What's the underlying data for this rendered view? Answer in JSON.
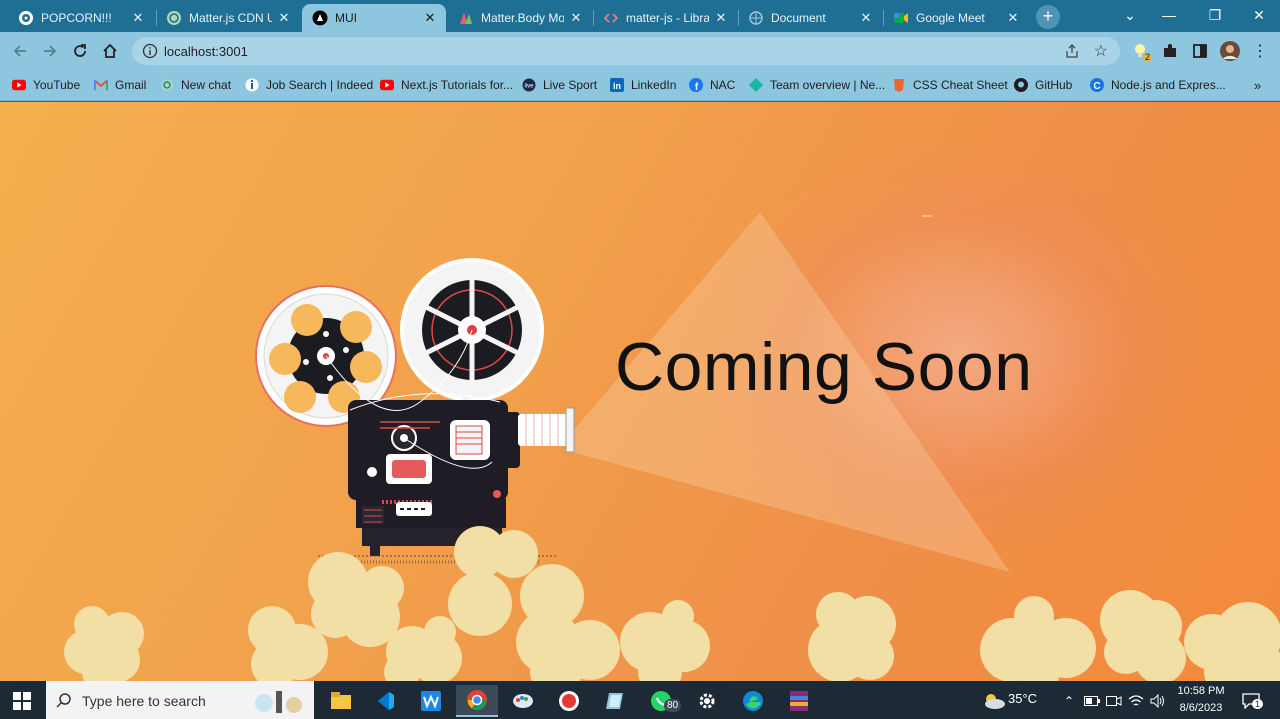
{
  "tabs": [
    {
      "title": "POPCORN!!!",
      "icon": "popcorn-logo-icon",
      "active": false
    },
    {
      "title": "Matter.js CDN Us",
      "icon": "chatgpt-icon",
      "active": false
    },
    {
      "title": "MUI",
      "icon": "nextjs-icon",
      "active": true
    },
    {
      "title": "Matter.Body Mod",
      "icon": "matterjs-icon",
      "active": false
    },
    {
      "title": "matter-js - Librar",
      "icon": "code-icon",
      "active": false
    },
    {
      "title": "Document",
      "icon": "globe-icon",
      "active": false
    },
    {
      "title": "Google Meet",
      "icon": "google-meet-icon",
      "active": false
    }
  ],
  "address_bar": {
    "url": "localhost:3001"
  },
  "extensions": {
    "badge_count": "2"
  },
  "bookmarks": [
    {
      "label": "YouTube",
      "icon": "youtube-icon"
    },
    {
      "label": "Gmail",
      "icon": "gmail-icon"
    },
    {
      "label": "New chat",
      "icon": "chatgpt-icon"
    },
    {
      "label": "Job Search | Indeed",
      "icon": "indeed-icon"
    },
    {
      "label": "Next.js Tutorials for...",
      "icon": "youtube-icon"
    },
    {
      "label": "Live Sport",
      "icon": "livesport-icon"
    },
    {
      "label": "LinkedIn",
      "icon": "linkedin-icon"
    },
    {
      "label": "NAC",
      "icon": "facebook-icon"
    },
    {
      "label": "Team overview | Ne...",
      "icon": "diamond-icon"
    },
    {
      "label": "CSS Cheat Sheet",
      "icon": "css-icon"
    },
    {
      "label": "GitHub",
      "icon": "github-icon"
    },
    {
      "label": "Node.js and Expres...",
      "icon": "c-icon"
    }
  ],
  "page": {
    "heading": "Coming Soon"
  },
  "taskbar": {
    "search_placeholder": "Type here to search",
    "whatsapp_badge": "80",
    "temperature": "35°C",
    "time": "10:58 PM",
    "date": "8/6/2023",
    "notification_count": "1"
  },
  "colors": {
    "tabstrip": "#1f6f94",
    "toolbar": "#8ec6e0",
    "page_orange": "#f2a24c",
    "popcorn": "#f1dfa6",
    "taskbar": "#1d2a35"
  }
}
